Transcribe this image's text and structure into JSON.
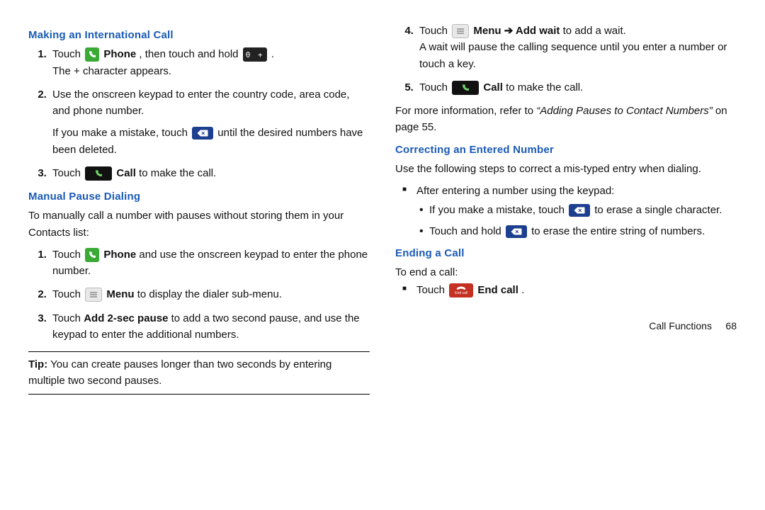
{
  "left": {
    "h1": "Making an International Call",
    "intl": {
      "s1a": "Touch ",
      "s1b": " Phone",
      "s1c": ", then touch and hold ",
      "s1d": ".",
      "s1e": "The + character appears.",
      "s2a": "Use the onscreen keypad to enter the country code, area code, and phone number.",
      "s2b": "If you make a mistake, touch ",
      "s2c": " until the desired numbers have been deleted.",
      "s3a": "Touch ",
      "s3b": " Call",
      "s3c": " to make the call."
    },
    "h2": "Manual Pause Dialing",
    "mpd_intro": "To manually call a number with pauses without storing them in your Contacts list:",
    "mpd": {
      "s1a": "Touch ",
      "s1b": " Phone",
      "s1c": " and use the onscreen keypad to enter the phone number.",
      "s2a": "Touch ",
      "s2b": " Menu",
      "s2c": " to display the dialer sub-menu.",
      "s3a": "Touch ",
      "s3b": "Add 2-sec pause",
      "s3c": " to add a two second pause, and use the keypad to enter the additional numbers."
    },
    "tip_label": "Tip:",
    "tip_text": " You can create pauses longer than two seconds by entering multiple two second pauses."
  },
  "right": {
    "s4a": "Touch ",
    "s4b": " Menu",
    "s4arrow": " ➔ ",
    "s4c": "Add wait",
    "s4d": " to add a wait.",
    "s4e": "A wait will pause the calling sequence until you enter a number or touch a key.",
    "s5a": "Touch ",
    "s5b": " Call",
    "s5c": " to make the call.",
    "ref1": "For more information, refer to ",
    "ref2": "“Adding Pauses to Contact Numbers”",
    "ref3": " on page 55.",
    "h3": "Correcting an Entered Number",
    "corr_intro": "Use the following steps to correct a mis-typed entry when dialing.",
    "corr_sq": "After entering a number using the keypad:",
    "corr_b1a": "If you make a mistake, touch ",
    "corr_b1b": " to erase a single character.",
    "corr_b2a": "Touch and hold ",
    "corr_b2b": " to erase the entire string of numbers.",
    "h4": "Ending a Call",
    "end_intro": "To end a call:",
    "end1a": "Touch ",
    "end1b": " End call",
    "end1c": "."
  },
  "footer": {
    "section": "Call Functions",
    "page": "68"
  },
  "zero_key": "0 +"
}
